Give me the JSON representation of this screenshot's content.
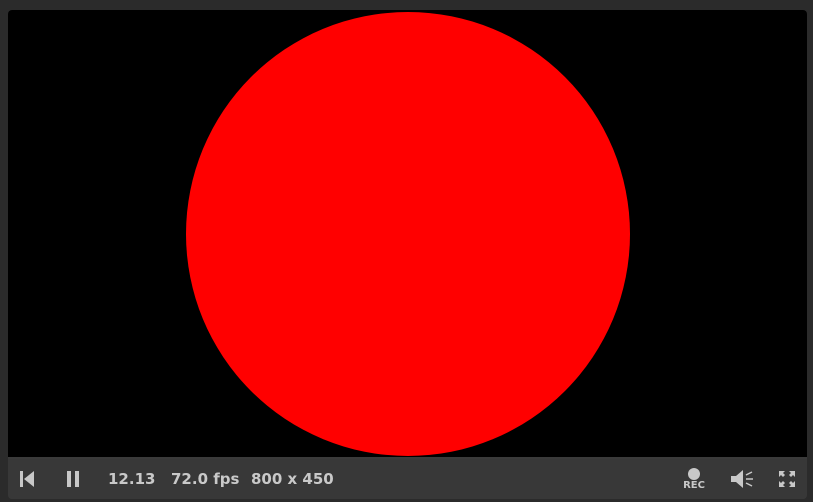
{
  "canvas": {
    "background": "#000000",
    "shape_color": "#ff0000"
  },
  "controls": {
    "time": "12.13",
    "fps": "72.0 fps",
    "resolution": "800 x 450",
    "record_label": "REC",
    "icons": {
      "rewind": "skip-to-start-icon",
      "pause": "pause-icon",
      "record": "record-icon",
      "volume": "volume-icon",
      "fullscreen": "fullscreen-icon"
    }
  }
}
